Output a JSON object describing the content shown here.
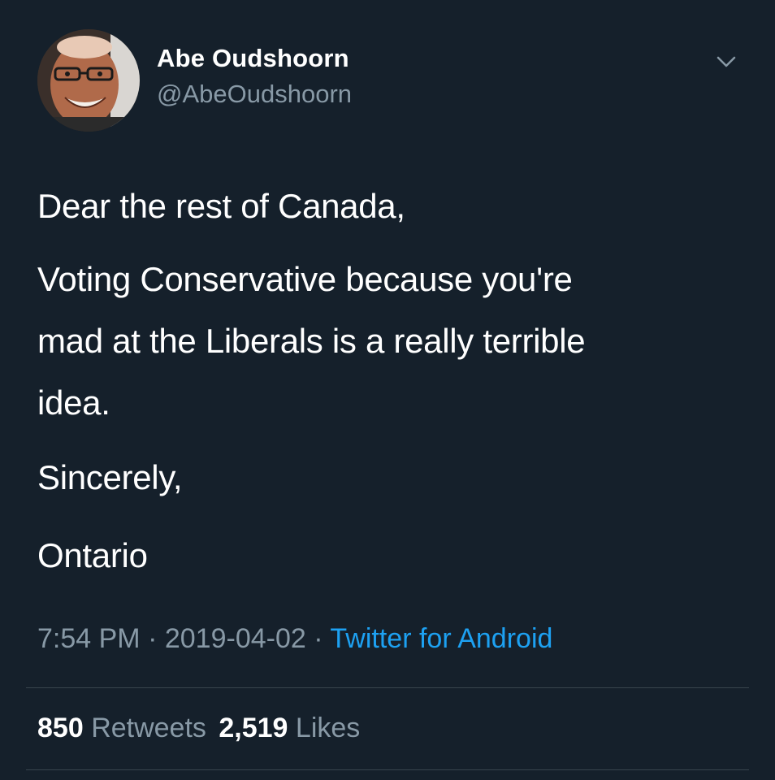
{
  "author": {
    "name": "Abe Oudshoorn",
    "handle": "@AbeOudshoorn"
  },
  "tweet": {
    "lines": [
      "Dear the rest of Canada,",
      "Voting Conservative because you're",
      "mad at the Liberals is a really terrible",
      "idea.",
      "Sincerely,",
      "Ontario"
    ]
  },
  "meta": {
    "time": "7:54 PM",
    "separator": "·",
    "date": "2019-04-02",
    "source": "Twitter for Android"
  },
  "stats": {
    "retweets_count": "850",
    "retweets_label": "Retweets",
    "likes_count": "2,519",
    "likes_label": "Likes"
  },
  "icons": {
    "menu": "chevron-down-icon"
  },
  "colors": {
    "background": "#15202b",
    "text": "#ffffff",
    "secondary": "#8899a6",
    "link": "#1da1f2",
    "divider": "#38444d"
  }
}
